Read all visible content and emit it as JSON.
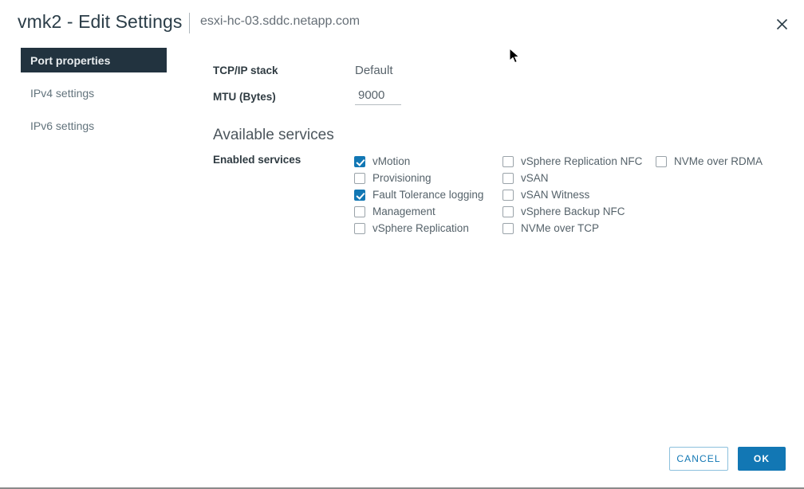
{
  "header": {
    "title": "vmk2 - Edit Settings",
    "separator": "|",
    "subtitle": "esxi-hc-03.sddc.netapp.com",
    "close_icon": "close-icon"
  },
  "sidebar": {
    "items": [
      {
        "label": "Port properties",
        "selected": true
      },
      {
        "label": "IPv4 settings",
        "selected": false
      },
      {
        "label": "IPv6 settings",
        "selected": false
      }
    ]
  },
  "form": {
    "tcpip_label": "TCP/IP stack",
    "tcpip_value": "Default",
    "mtu_label": "MTU (Bytes)",
    "mtu_value": "9000",
    "mtu_placeholder": "9000",
    "section_title": "Available services",
    "enabled_services_label": "Enabled services",
    "service_columns": [
      [
        {
          "label": "vMotion",
          "checked": true
        },
        {
          "label": "Provisioning",
          "checked": false
        },
        {
          "label": "Fault Tolerance logging",
          "checked": true
        },
        {
          "label": "Management",
          "checked": false
        },
        {
          "label": "vSphere Replication",
          "checked": false
        }
      ],
      [
        {
          "label": "vSphere Replication NFC",
          "checked": false
        },
        {
          "label": "vSAN",
          "checked": false
        },
        {
          "label": "vSAN Witness",
          "checked": false
        },
        {
          "label": "vSphere Backup NFC",
          "checked": false
        },
        {
          "label": "NVMe over TCP",
          "checked": false
        }
      ],
      [
        {
          "label": "NVMe over RDMA",
          "checked": false
        }
      ]
    ]
  },
  "footer": {
    "cancel_label": "CANCEL",
    "ok_label": "OK"
  },
  "colors": {
    "accent_blue": "#1277b4",
    "selected_nav_bg": "#22333f",
    "text_primary": "#2f3b42",
    "text_secondary": "#58636b"
  }
}
